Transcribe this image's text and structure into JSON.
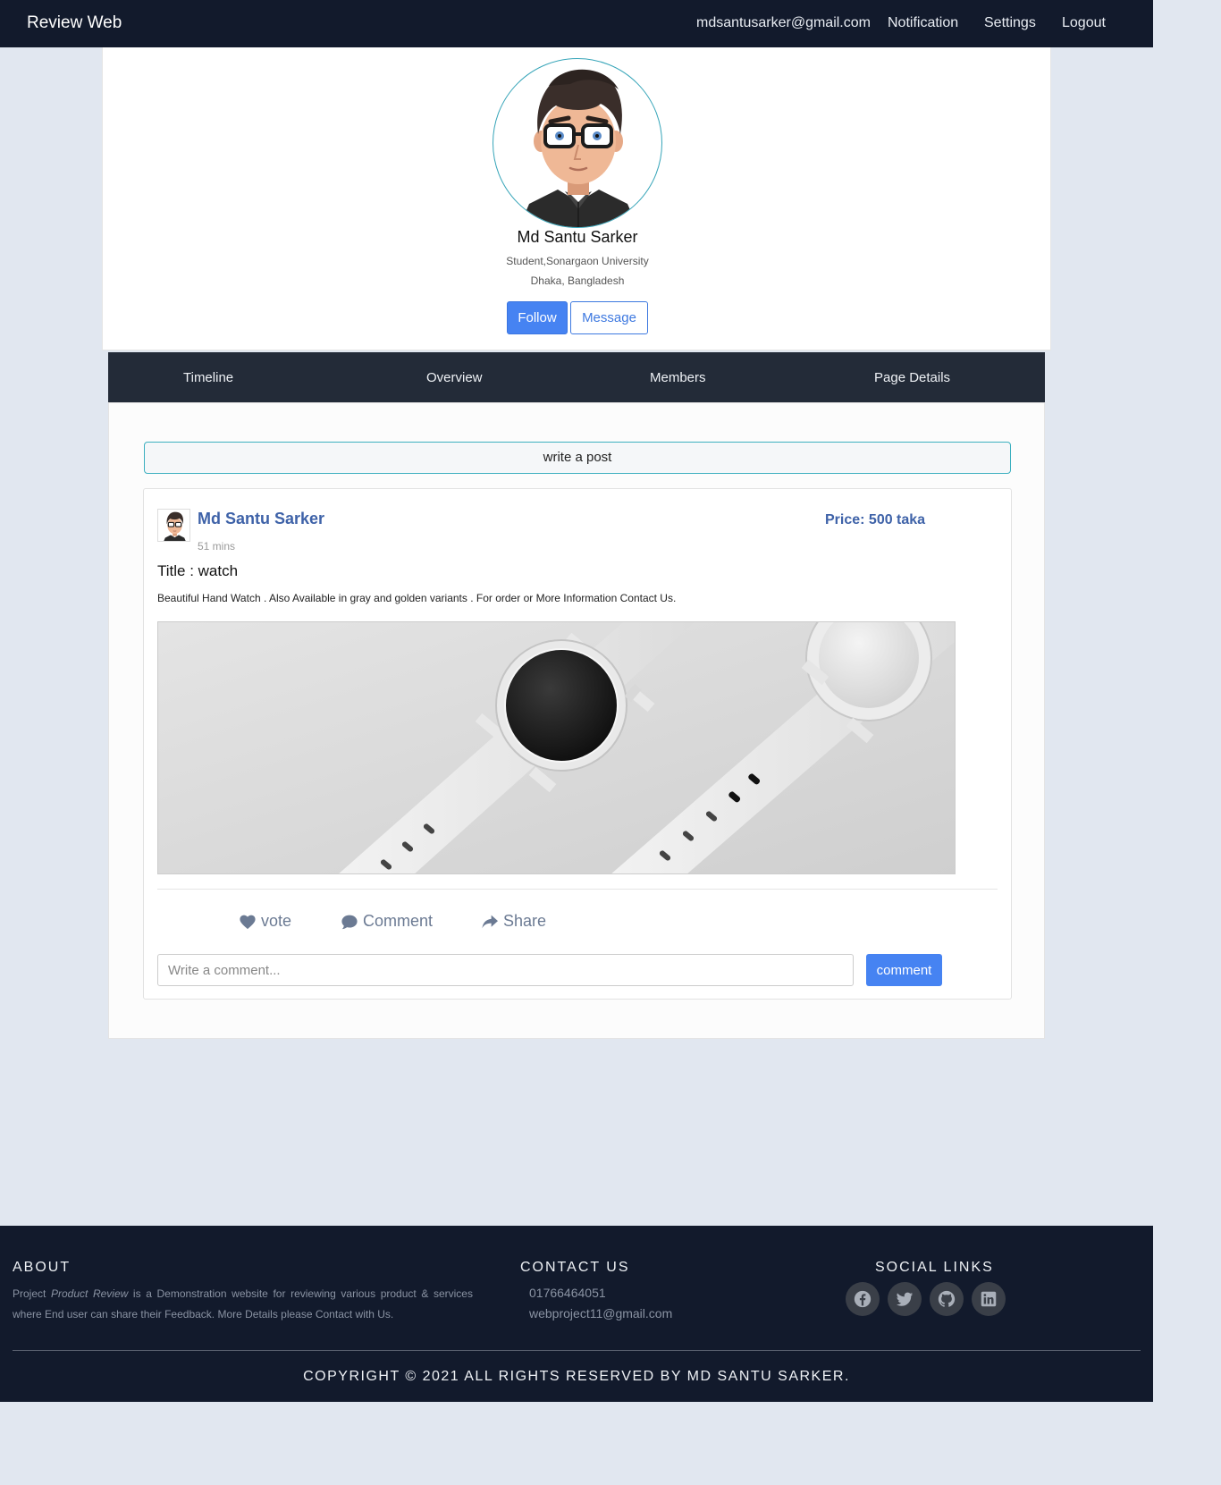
{
  "nav": {
    "brand": "Review Web",
    "email": "mdsantusarker@gmail.com",
    "notification": "Notification",
    "settings": "Settings",
    "logout": "Logout"
  },
  "profile": {
    "name": "Md Santu Sarker",
    "occupation": "Student,Sonargaon University",
    "location": "Dhaka, Bangladesh",
    "follow_label": "Follow",
    "message_label": "Message"
  },
  "tabs": [
    "Timeline",
    "Overview",
    "Members",
    "Page Details"
  ],
  "write_post": "write a post",
  "post": {
    "author": "Md Santu Sarker",
    "time": "51 mins",
    "price": "Price: 500 taka",
    "title": "Title : watch",
    "description": "Beautiful Hand Watch . Also Available in gray and golden variants . For order or More Information Contact Us.",
    "actions": {
      "vote": "vote",
      "comment": "Comment",
      "share": "Share"
    },
    "comment_placeholder": "Write a comment...",
    "comment_button": "comment"
  },
  "footer": {
    "about_title": "ABOUT",
    "about_pre": "Project ",
    "about_em": "Product Review",
    "about_post": " is a Demonstration website for reviewing various product & services where End user can share their Feedback. More Details please Contact with Us.",
    "contact_title": "CONTACT US",
    "phone": "01766464051",
    "email": "webproject11@gmail.com",
    "social_title": "SOCIAL LINKS",
    "social_icons": [
      "facebook-icon",
      "twitter-icon",
      "github-icon",
      "linkedin-icon"
    ],
    "copyright": "COPYRIGHT © 2021 ALL RIGHTS RESERVED BY MD SANTU SARKER."
  },
  "colors": {
    "nav_bg": "#121a2c",
    "tab_bg": "#232b38",
    "accent_blue": "#4683f2",
    "author_blue": "#3e62a8",
    "page_bg": "#e1e7f0"
  }
}
